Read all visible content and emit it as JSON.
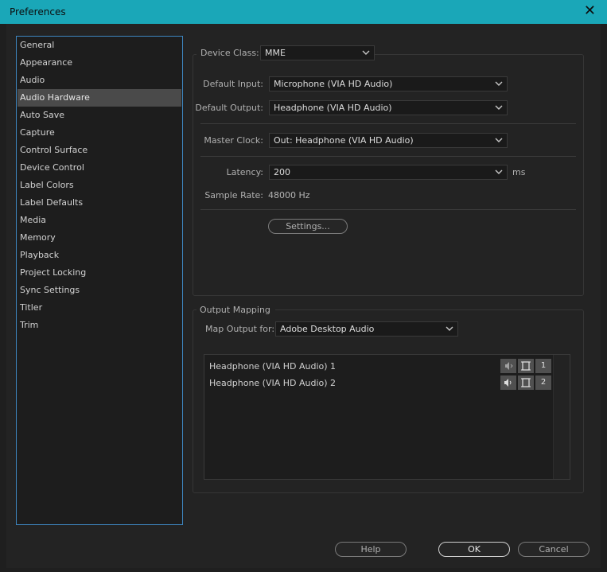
{
  "window": {
    "title": "Preferences",
    "close_glyph": "✕"
  },
  "sidebar": {
    "items": [
      {
        "label": "General"
      },
      {
        "label": "Appearance"
      },
      {
        "label": "Audio"
      },
      {
        "label": "Audio Hardware",
        "selected": true
      },
      {
        "label": "Auto Save"
      },
      {
        "label": "Capture"
      },
      {
        "label": "Control Surface"
      },
      {
        "label": "Device Control"
      },
      {
        "label": "Label Colors"
      },
      {
        "label": "Label Defaults"
      },
      {
        "label": "Media"
      },
      {
        "label": "Memory"
      },
      {
        "label": "Playback"
      },
      {
        "label": "Project Locking"
      },
      {
        "label": "Sync Settings"
      },
      {
        "label": "Titler"
      },
      {
        "label": "Trim"
      }
    ]
  },
  "device": {
    "class_label": "Device Class:",
    "class_value": "MME",
    "input_label": "Default Input:",
    "input_value": "Microphone (VIA HD Audio)",
    "output_label": "Default Output:",
    "output_value": "Headphone (VIA HD Audio)",
    "clock_label": "Master Clock:",
    "clock_value": "Out: Headphone (VIA HD Audio)",
    "latency_label": "Latency:",
    "latency_value": "200",
    "latency_unit": "ms",
    "sample_rate_label": "Sample Rate:",
    "sample_rate_value": "48000 Hz",
    "settings_button": "Settings..."
  },
  "output_mapping": {
    "group_label": "Output Mapping",
    "map_for_label": "Map Output for:",
    "map_for_value": "Adobe Desktop Audio",
    "channels": [
      {
        "name": "Headphone (VIA HD Audio) 1",
        "number": "1",
        "icon": "speaker-dim-icon"
      },
      {
        "name": "Headphone (VIA HD Audio) 2",
        "number": "2",
        "icon": "speaker-icon"
      }
    ]
  },
  "footer": {
    "help_label": "Help",
    "ok_label": "OK",
    "cancel_label": "Cancel"
  },
  "colors": {
    "titlebar": "#1aa7b8",
    "selection": "#4a4a4a",
    "list_border": "#3e86c0"
  }
}
